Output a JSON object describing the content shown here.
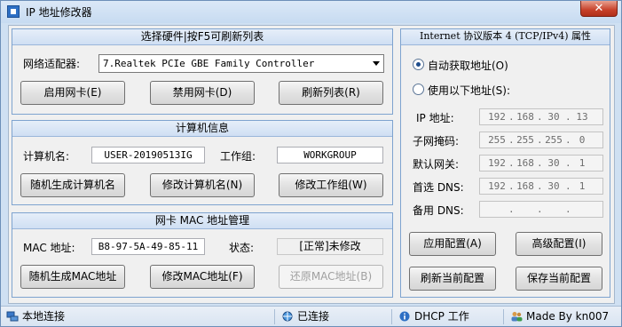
{
  "window": {
    "title": "IP 地址修改器",
    "close_glyph": "✕"
  },
  "adapter_group": {
    "title": "选择硬件|按F5可刷新列表",
    "adapter_label": "网络适配器:",
    "adapter_selected": "7.Realtek PCIe GBE Family Controller",
    "enable_button": "启用网卡(E)",
    "disable_button": "禁用网卡(D)",
    "refresh_list_button": "刷新列表(R)"
  },
  "computer_group": {
    "title": "计算机信息",
    "name_label": "计算机名:",
    "name_value": "USER-20190513IG",
    "workgroup_label": "工作组:",
    "workgroup_value": "WORKGROUP",
    "random_name_button": "随机生成计算机名",
    "change_name_button": "修改计算机名(N)",
    "change_workgroup_button": "修改工作组(W)"
  },
  "mac_group": {
    "title": "网卡 MAC 地址管理",
    "mac_label": "MAC 地址:",
    "mac_value": "B8-97-5A-49-85-11",
    "status_label": "状态:",
    "status_value": "[正常]未修改",
    "random_mac_button": "随机生成MAC地址",
    "change_mac_button": "修改MAC地址(F)",
    "restore_mac_button": "还原MAC地址(B)"
  },
  "ipv4_group": {
    "title": "Internet 协议版本 4 (TCP/IPv4) 属性",
    "auto_label": "自动获取地址(O)",
    "manual_label": "使用以下地址(S):",
    "auto_selected": true,
    "ip_label": "IP 地址:",
    "ip": [
      "192",
      "168",
      "30",
      "13"
    ],
    "mask_label": "子网掩码:",
    "mask": [
      "255",
      "255",
      "255",
      "0"
    ],
    "gateway_label": "默认网关:",
    "gateway": [
      "192",
      "168",
      "30",
      "1"
    ],
    "dns1_label": "首选 DNS:",
    "dns1": [
      "192",
      "168",
      "30",
      "1"
    ],
    "dns2_label": "备用 DNS:",
    "dns2": [
      "",
      "",
      "",
      ""
    ],
    "apply_button": "应用配置(A)",
    "advanced_button": "高级配置(I)",
    "refresh_button": "刷新当前配置",
    "save_button": "保存当前配置"
  },
  "statusbar": {
    "connection": "本地连接",
    "state": "已连接",
    "dhcp": "DHCP 工作",
    "credit": "Made By kn007"
  },
  "colors": {
    "accent": "#2d6fc4",
    "group_border": "#7ea3cf",
    "window_frame": "#cfe0f2"
  }
}
